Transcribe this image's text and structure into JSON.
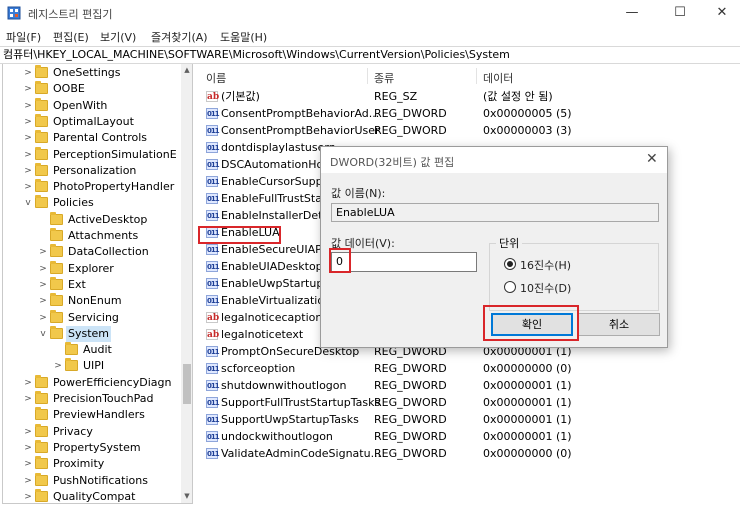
{
  "window": {
    "title": "레지스트리 편집기",
    "minimize": "—",
    "maximize": "☐",
    "close": "✕"
  },
  "menu": [
    "파일(F)",
    "편집(E)",
    "보기(V)",
    "즐겨찾기(A)",
    "도움말(H)"
  ],
  "address": "컴퓨터\\HKEY_LOCAL_MACHINE\\SOFTWARE\\Microsoft\\Windows\\CurrentVersion\\Policies\\System",
  "tree": [
    {
      "label": "OneSettings",
      "chevron": ">"
    },
    {
      "label": "OOBE",
      "chevron": ">"
    },
    {
      "label": "OpenWith",
      "chevron": ">"
    },
    {
      "label": "OptimalLayout",
      "chevron": ">"
    },
    {
      "label": "Parental Controls",
      "chevron": ">"
    },
    {
      "label": "PerceptionSimulationE",
      "chevron": ">"
    },
    {
      "label": "Personalization",
      "chevron": ">"
    },
    {
      "label": "PhotoPropertyHandler",
      "chevron": ">"
    },
    {
      "label": "Policies",
      "chevron": "v"
    },
    {
      "label": "ActiveDesktop",
      "chevron": ""
    },
    {
      "label": "Attachments",
      "chevron": ""
    },
    {
      "label": "DataCollection",
      "chevron": ">"
    },
    {
      "label": "Explorer",
      "chevron": ">"
    },
    {
      "label": "Ext",
      "chevron": ">"
    },
    {
      "label": "NonEnum",
      "chevron": ">"
    },
    {
      "label": "Servicing",
      "chevron": ">"
    },
    {
      "label": "System",
      "chevron": "v"
    },
    {
      "label": "Audit",
      "chevron": ""
    },
    {
      "label": "UIPI",
      "chevron": ">"
    },
    {
      "label": "PowerEfficiencyDiagn",
      "chevron": ">"
    },
    {
      "label": "PrecisionTouchPad",
      "chevron": ">"
    },
    {
      "label": "PreviewHandlers",
      "chevron": ""
    },
    {
      "label": "Privacy",
      "chevron": ">"
    },
    {
      "label": "PropertySystem",
      "chevron": ">"
    },
    {
      "label": "Proximity",
      "chevron": ">"
    },
    {
      "label": "PushNotifications",
      "chevron": ">"
    },
    {
      "label": "QualityCompat",
      "chevron": ">"
    }
  ],
  "columns": {
    "name": "이름",
    "type": "종류",
    "data": "데이터"
  },
  "values": [
    {
      "icon": "ab",
      "name": "(기본값)",
      "type": "REG_SZ",
      "data": "(값 설정 안 됨)"
    },
    {
      "icon": "bin",
      "name": "ConsentPromptBehaviorAd...",
      "type": "REG_DWORD",
      "data": "0x00000005 (5)"
    },
    {
      "icon": "bin",
      "name": "ConsentPromptBehaviorUser",
      "type": "REG_DWORD",
      "data": "0x00000003 (3)"
    },
    {
      "icon": "bin",
      "name": "dontdisplaylastusern",
      "type": "",
      "data": ""
    },
    {
      "icon": "bin",
      "name": "DSCAutomationHos",
      "type": "",
      "data": ""
    },
    {
      "icon": "bin",
      "name": "EnableCursorSuppres",
      "type": "",
      "data": ""
    },
    {
      "icon": "bin",
      "name": "EnableFullTrustStartu",
      "type": "",
      "data": ""
    },
    {
      "icon": "bin",
      "name": "EnableInstallerDetect",
      "type": "",
      "data": ""
    },
    {
      "icon": "bin",
      "name": "EnableLUA",
      "type": "",
      "data": ""
    },
    {
      "icon": "bin",
      "name": "EnableSecureUIAPath",
      "type": "",
      "data": ""
    },
    {
      "icon": "bin",
      "name": "EnableUIADesktopTo",
      "type": "",
      "data": ""
    },
    {
      "icon": "bin",
      "name": "EnableUwpStartupTa",
      "type": "",
      "data": ""
    },
    {
      "icon": "bin",
      "name": "EnableVirtualization",
      "type": "",
      "data": ""
    },
    {
      "icon": "ab",
      "name": "legalnoticecaption",
      "type": "",
      "data": ""
    },
    {
      "icon": "ab",
      "name": "legalnoticetext",
      "type": "",
      "data": ""
    },
    {
      "icon": "bin",
      "name": "PromptOnSecureDesktop",
      "type": "REG_DWORD",
      "data": "0x00000001 (1)"
    },
    {
      "icon": "bin",
      "name": "scforceoption",
      "type": "REG_DWORD",
      "data": "0x00000000 (0)"
    },
    {
      "icon": "bin",
      "name": "shutdownwithoutlogon",
      "type": "REG_DWORD",
      "data": "0x00000001 (1)"
    },
    {
      "icon": "bin",
      "name": "SupportFullTrustStartupTasks",
      "type": "REG_DWORD",
      "data": "0x00000001 (1)"
    },
    {
      "icon": "bin",
      "name": "SupportUwpStartupTasks",
      "type": "REG_DWORD",
      "data": "0x00000001 (1)"
    },
    {
      "icon": "bin",
      "name": "undockwithoutlogon",
      "type": "REG_DWORD",
      "data": "0x00000001 (1)"
    },
    {
      "icon": "bin",
      "name": "ValidateAdminCodeSignatu...",
      "type": "REG_DWORD",
      "data": "0x00000000 (0)"
    }
  ],
  "dialog": {
    "title": "DWORD(32비트) 값 편집",
    "close": "✕",
    "name_label": "값 이름(N):",
    "name_value": "EnableLUA",
    "data_label": "값 데이터(V):",
    "data_value": "0",
    "base_label": "단위",
    "hex_label": "16진수(H)",
    "dec_label": "10진수(D)",
    "ok": "확인",
    "cancel": "취소"
  },
  "colors": {
    "highlight": "#d9262a",
    "selection": "#cce4f7",
    "accent": "#0078d7"
  }
}
